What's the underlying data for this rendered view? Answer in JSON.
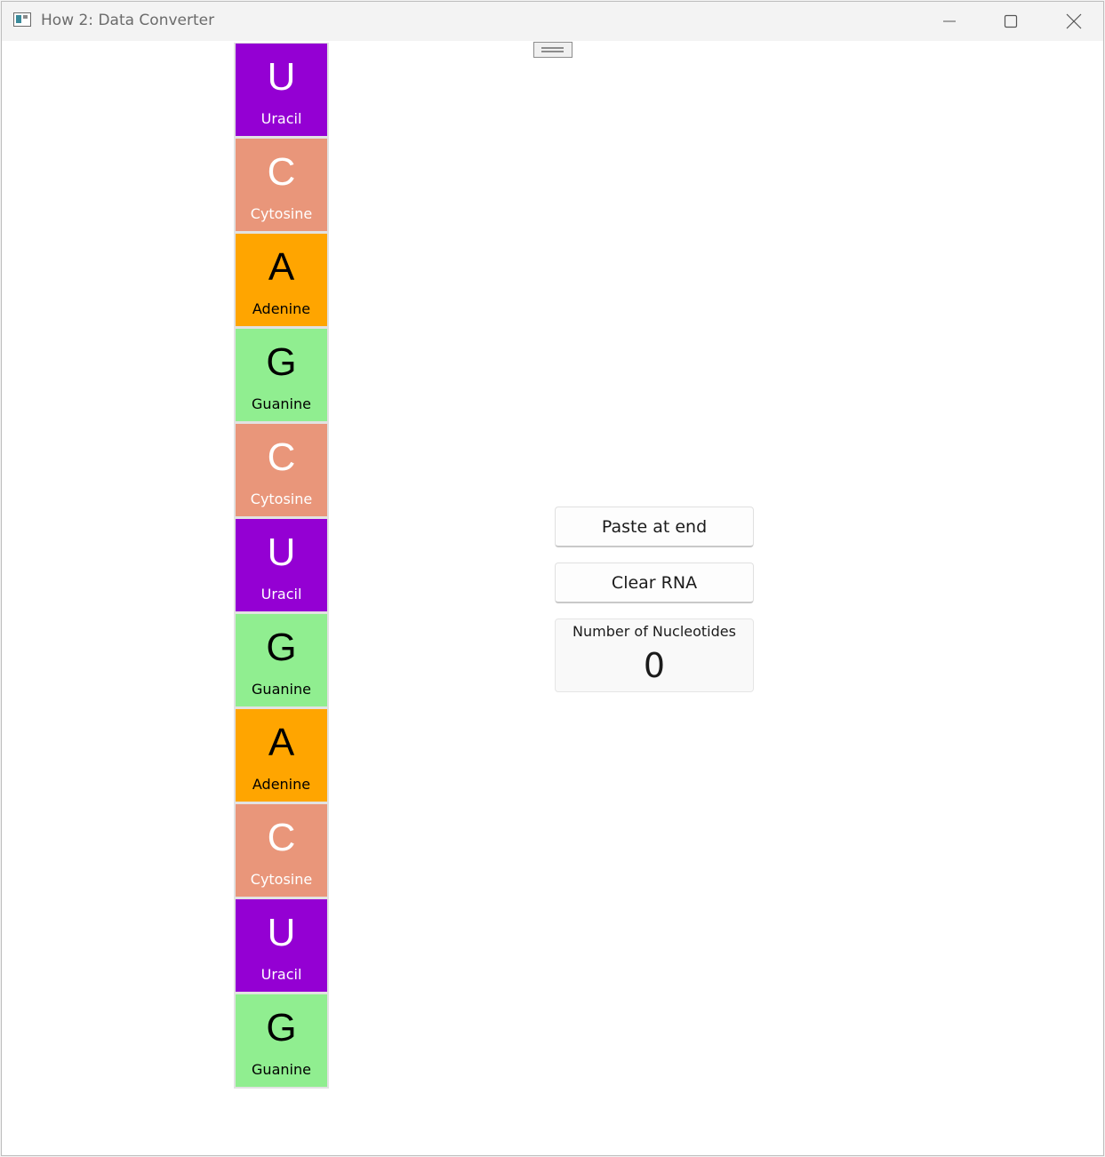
{
  "window": {
    "title": "How 2: Data Converter",
    "controls": [
      "minimize-icon",
      "maximize-icon",
      "close-icon"
    ]
  },
  "strand": {
    "nucleotides": [
      {
        "letter": "U",
        "name": "Uracil",
        "color": "#9400d3",
        "text_color": "#ffffff"
      },
      {
        "letter": "C",
        "name": "Cytosine",
        "color": "#e9967a",
        "text_color": "#ffffff"
      },
      {
        "letter": "A",
        "name": "Adenine",
        "color": "#ffa500",
        "text_color": "#000000"
      },
      {
        "letter": "G",
        "name": "Guanine",
        "color": "#90ee90",
        "text_color": "#000000"
      },
      {
        "letter": "C",
        "name": "Cytosine",
        "color": "#e9967a",
        "text_color": "#ffffff"
      },
      {
        "letter": "U",
        "name": "Uracil",
        "color": "#9400d3",
        "text_color": "#ffffff"
      },
      {
        "letter": "G",
        "name": "Guanine",
        "color": "#90ee90",
        "text_color": "#000000"
      },
      {
        "letter": "A",
        "name": "Adenine",
        "color": "#ffa500",
        "text_color": "#000000"
      },
      {
        "letter": "C",
        "name": "Cytosine",
        "color": "#e9967a",
        "text_color": "#ffffff"
      },
      {
        "letter": "U",
        "name": "Uracil",
        "color": "#9400d3",
        "text_color": "#ffffff"
      },
      {
        "letter": "G",
        "name": "Guanine",
        "color": "#90ee90",
        "text_color": "#000000"
      }
    ]
  },
  "actions": {
    "paste_label": "Paste at end",
    "clear_label": "Clear RNA"
  },
  "counter": {
    "label": "Number of Nucleotides",
    "value": "0"
  }
}
